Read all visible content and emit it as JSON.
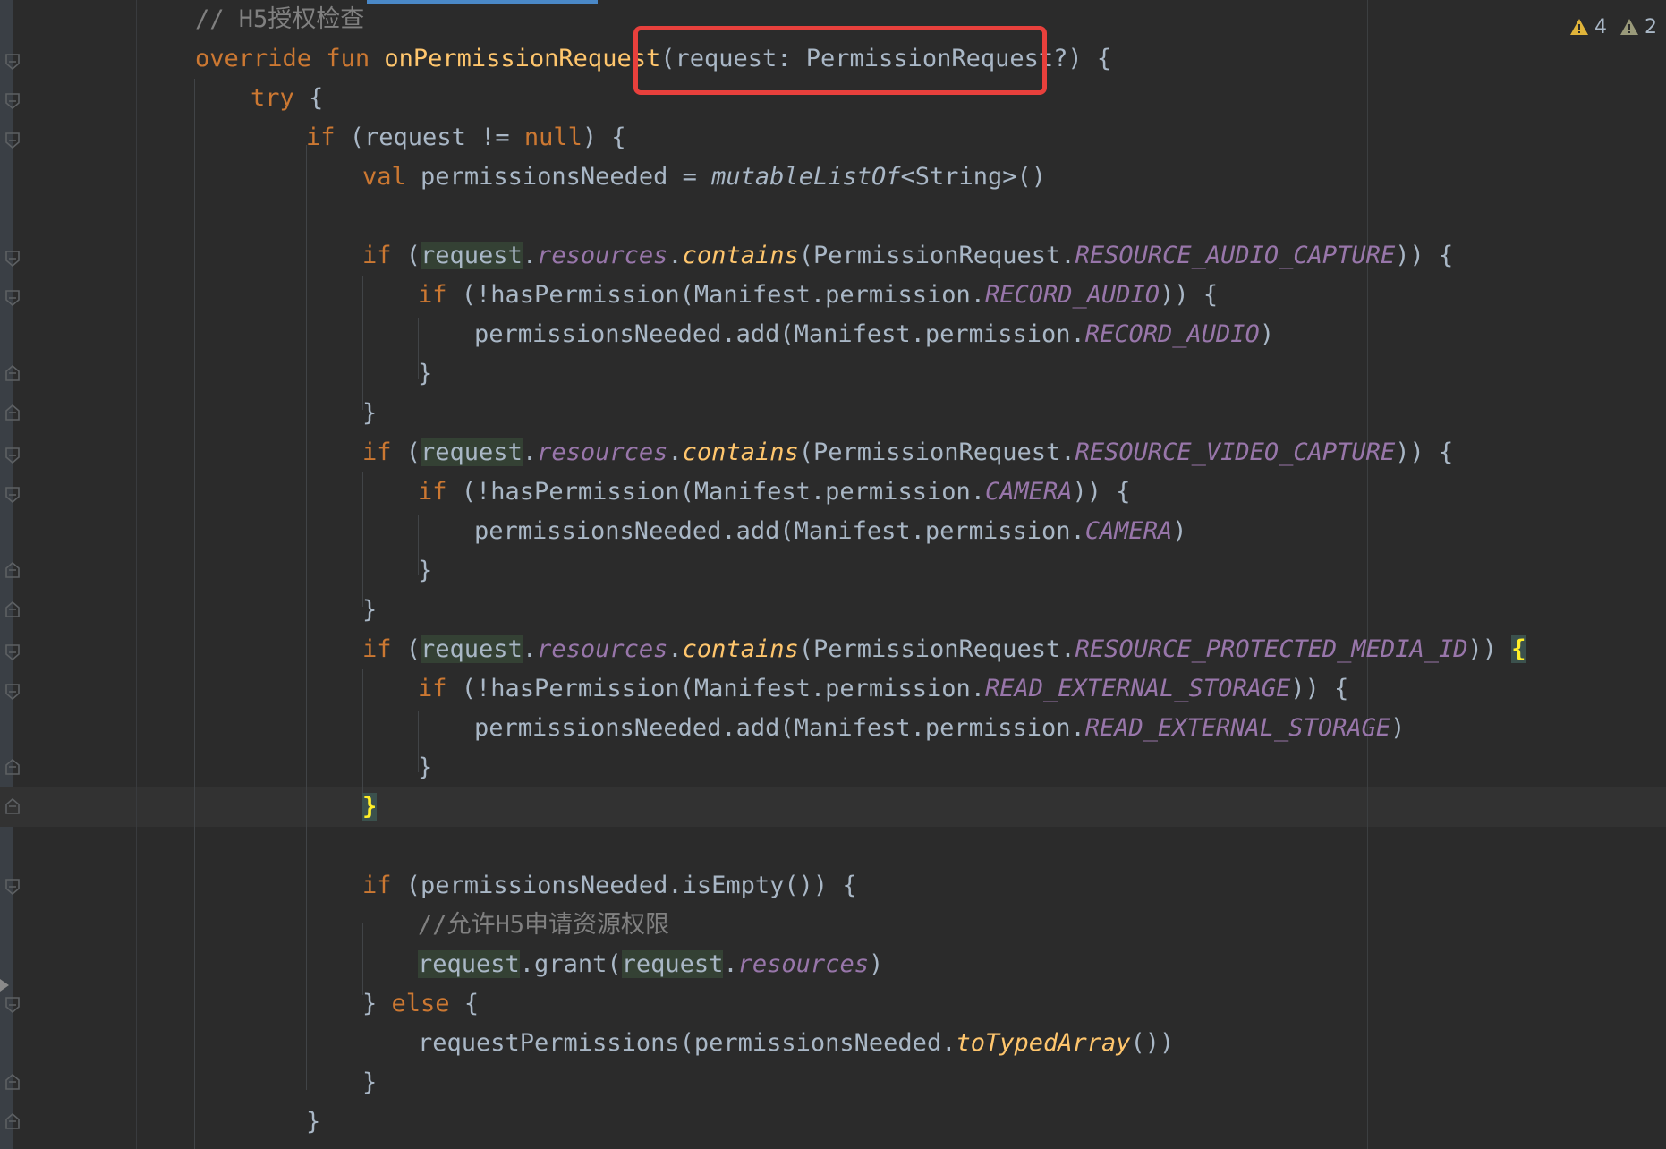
{
  "inspections": {
    "warnings_count": "4",
    "weak_warnings_count": "2",
    "warning_color": "#e0b43a",
    "weak_warning_color": "#9a9a7a"
  },
  "code": {
    "comment_h5_auth": "// H5授权检查",
    "kw_override": "override",
    "kw_fun": "fun",
    "fn_name": "onPermissionRequest",
    "params": "(request: PermissionRequest?)",
    "open_brace": "{",
    "close_brace": "}",
    "kw_try": "try",
    "kw_if": "if",
    "kw_else": "else",
    "kw_val": "val",
    "kw_null": "null",
    "request_null_check_open": "(request != ",
    "paren_close_brace": ") {",
    "permissions_decl": "permissionsNeeded = ",
    "mutable_list_of": "mutableListOf",
    "string_generic": "<String>()",
    "request": "request",
    "resources": "resources",
    "contains": "contains",
    "permission_request_prefix": "(PermissionRequest.",
    "resource_audio_capture": "RESOURCE_AUDIO_CAPTURE",
    "resource_video_capture": "RESOURCE_VIDEO_CAPTURE",
    "resource_protected_media_id": "RESOURCE_PROTECTED_MEDIA_ID",
    "has_permission_open": "(!hasPermission(Manifest.permission.",
    "record_audio": "RECORD_AUDIO",
    "camera": "CAMERA",
    "read_external_storage": "READ_EXTERNAL_STORAGE",
    "double_paren_brace": ")) {",
    "double_paren": "))",
    "add_open": "permissionsNeeded.add(Manifest.permission.",
    "close_paren": ")",
    "is_empty_cond": "(permissionsNeeded.isEmpty()) {",
    "comment_allow_h5": "//允许H5申请资源权限",
    "grant_open": ".grant(",
    "request_permissions_open": "requestPermissions(permissionsNeeded.",
    "to_typed_array": "toTypedArray",
    "empty_call_close": "())",
    "close_brace_else": "} "
  }
}
